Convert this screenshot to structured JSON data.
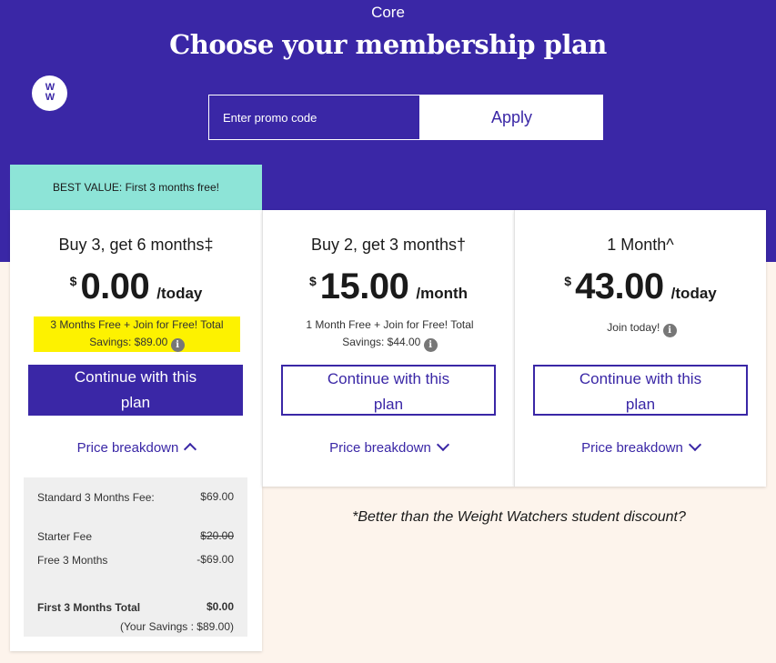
{
  "header": {
    "subtitle": "Core",
    "title": "Choose your membership plan",
    "logo_text": "WW"
  },
  "promo": {
    "placeholder": "Enter promo code",
    "apply_label": "Apply"
  },
  "badge": "BEST VALUE: First 3 months free!",
  "plans": [
    {
      "name": "Buy 3, get 6 months‡",
      "currency": "$",
      "amount": "0.00",
      "period": "/today",
      "savings": "3 Months Free + Join for Free! Total Savings: $89.00",
      "cta": "Continue with this plan",
      "breakdown_label": "Price breakdown",
      "breakdown": {
        "rows": [
          {
            "label": "Standard 3 Months Fee:",
            "value": "$69.00"
          },
          {
            "label": "Starter Fee",
            "value": "$20.00"
          },
          {
            "label": "Free 3 Months",
            "value": "-$69.00"
          }
        ],
        "total_label": "First 3 Months Total",
        "total_value": "$0.00",
        "note": "(Your Savings : $89.00)"
      }
    },
    {
      "name": "Buy 2, get 3 months†",
      "currency": "$",
      "amount": "15.00",
      "period": "/month",
      "savings": "1 Month Free + Join for Free! Total Savings: $44.00",
      "cta": "Continue with this plan",
      "breakdown_label": "Price breakdown"
    },
    {
      "name": "1 Month^",
      "currency": "$",
      "amount": "43.00",
      "period": "/today",
      "savings": "Join today!",
      "cta": "Continue with this plan",
      "breakdown_label": "Price breakdown"
    }
  ],
  "caption": "*Better than the Weight Watchers student discount?",
  "colors": {
    "brand": "#3a27a6",
    "badge": "#8de4d7",
    "highlight": "#fdf200",
    "background": "#fdf4ec"
  }
}
